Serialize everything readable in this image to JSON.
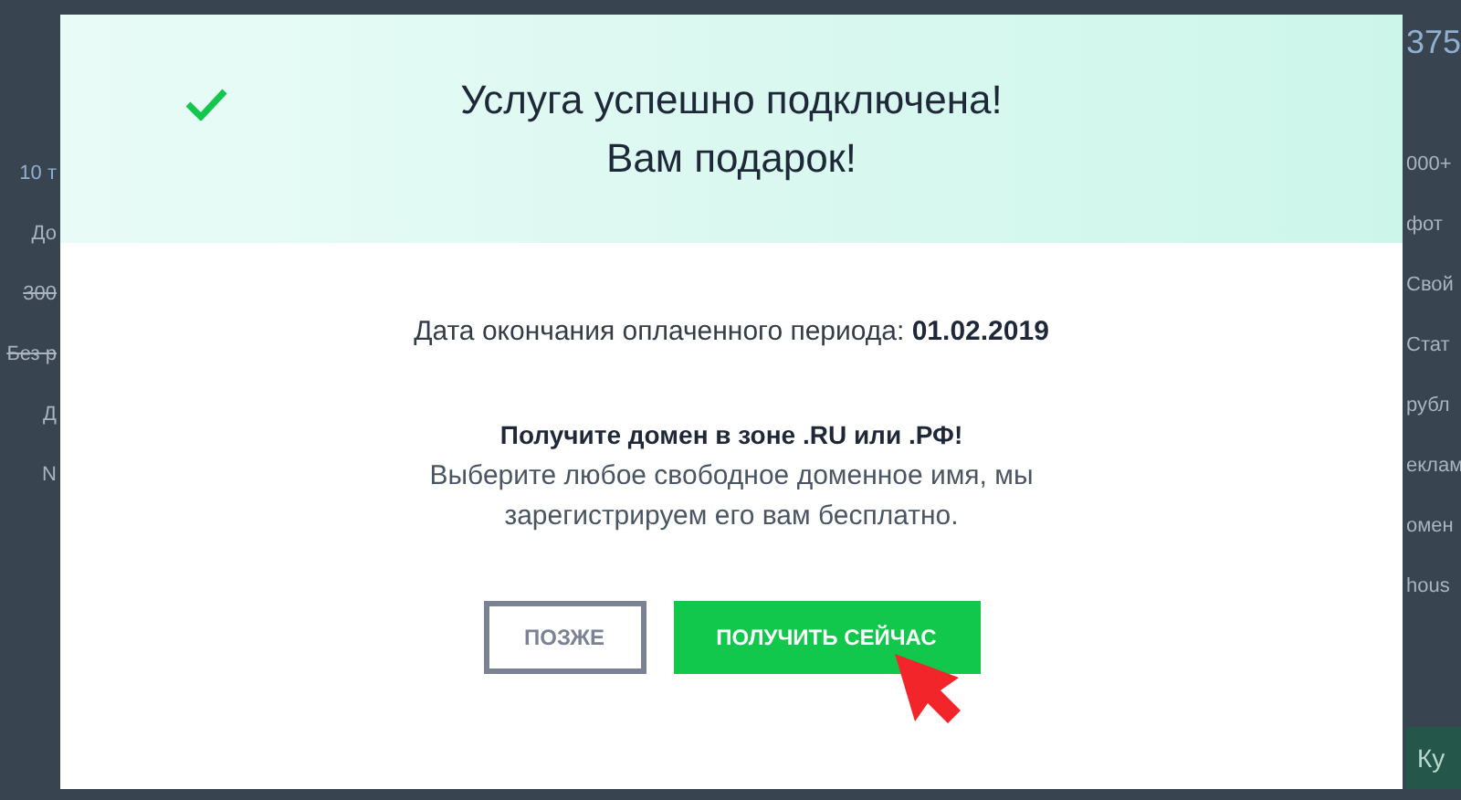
{
  "background": {
    "left": [
      {
        "kind": "heading",
        "text": "10 т"
      },
      {
        "kind": "text",
        "text": "До"
      },
      {
        "kind": "struck",
        "text": "300"
      },
      {
        "kind": "struck",
        "text": "Без р"
      },
      {
        "kind": "text",
        "text": "Д"
      },
      {
        "kind": "text",
        "text": "N"
      }
    ],
    "right": [
      {
        "kind": "price",
        "text": "375"
      },
      {
        "kind": "text",
        "text": "000+"
      },
      {
        "kind": "text",
        "text": "фот"
      },
      {
        "kind": "text",
        "text": "Свой"
      },
      {
        "kind": "text",
        "text": "Стат"
      },
      {
        "kind": "text",
        "text": "рубл"
      },
      {
        "kind": "text",
        "text": "еклам"
      },
      {
        "kind": "text",
        "text": "омен"
      },
      {
        "kind": "text",
        "text": "hous"
      }
    ],
    "right_button": "Ку"
  },
  "dialog": {
    "title": [
      "Услуга успешно подключена!",
      "Вам подарок!"
    ],
    "period_label": "Дата окончания оплаченного периода:",
    "period_date": "01.02.2019",
    "offer_title": "Получите домен в зоне .RU или .РФ!",
    "offer_text": "Выберите любое свободное доменное имя, мы зарегистрируем его вам бесплатно.",
    "buttons": [
      {
        "kind": "secondary",
        "label": "ПОЗЖЕ"
      },
      {
        "kind": "primary",
        "label": "ПОЛУЧИТЬ СЕЙЧАС"
      }
    ]
  }
}
